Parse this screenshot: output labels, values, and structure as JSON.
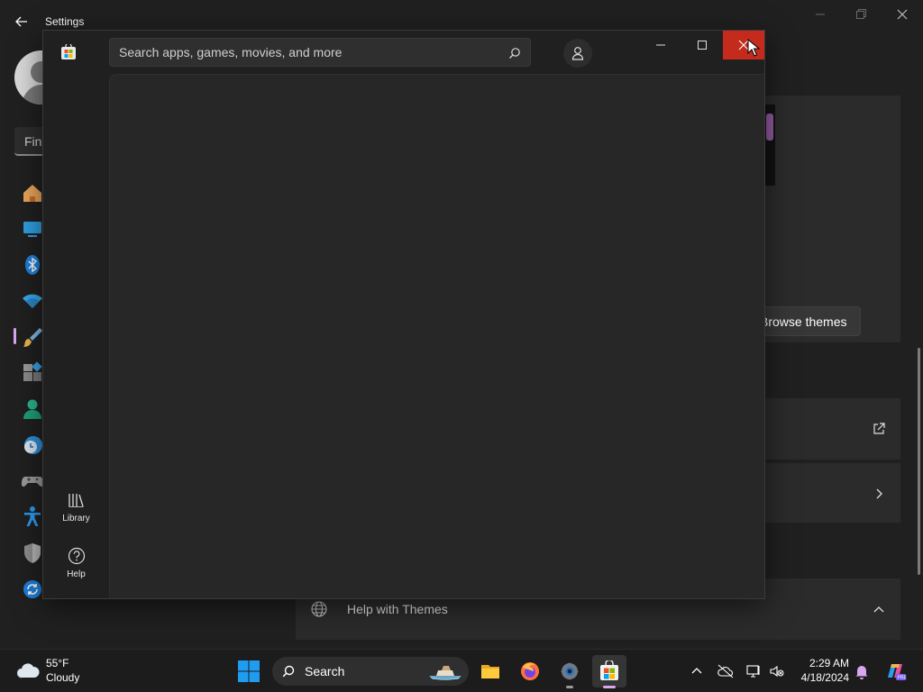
{
  "settings": {
    "title": "Settings",
    "find_text": "Find",
    "nav_icons": [
      "home-icon",
      "system-icon",
      "bluetooth-icon",
      "network-icon",
      "personalization-icon",
      "apps-icon",
      "accounts-icon",
      "time-language-icon",
      "gaming-icon",
      "accessibility-icon",
      "privacy-security-icon",
      "windows-update-icon"
    ],
    "browse_themes_label": "Browse themes",
    "help_with_themes_label": "Help with Themes"
  },
  "store": {
    "search_placeholder": "Search apps, games, movies, and more",
    "nav": {
      "library_label": "Library",
      "help_label": "Help"
    },
    "colors": {
      "close_button": "#c42b1c",
      "content_bg": "#272727"
    }
  },
  "taskbar": {
    "weather": {
      "temperature": "55°F",
      "condition": "Cloudy"
    },
    "search_label": "Search",
    "apps": [
      "file-explorer-icon",
      "firefox-icon",
      "settings-icon",
      "microsoft-store-icon"
    ],
    "active_app": "microsoft-store-icon",
    "clock": {
      "time": "2:29 AM",
      "date": "4/18/2024"
    },
    "accent": "#d7a7ef"
  }
}
